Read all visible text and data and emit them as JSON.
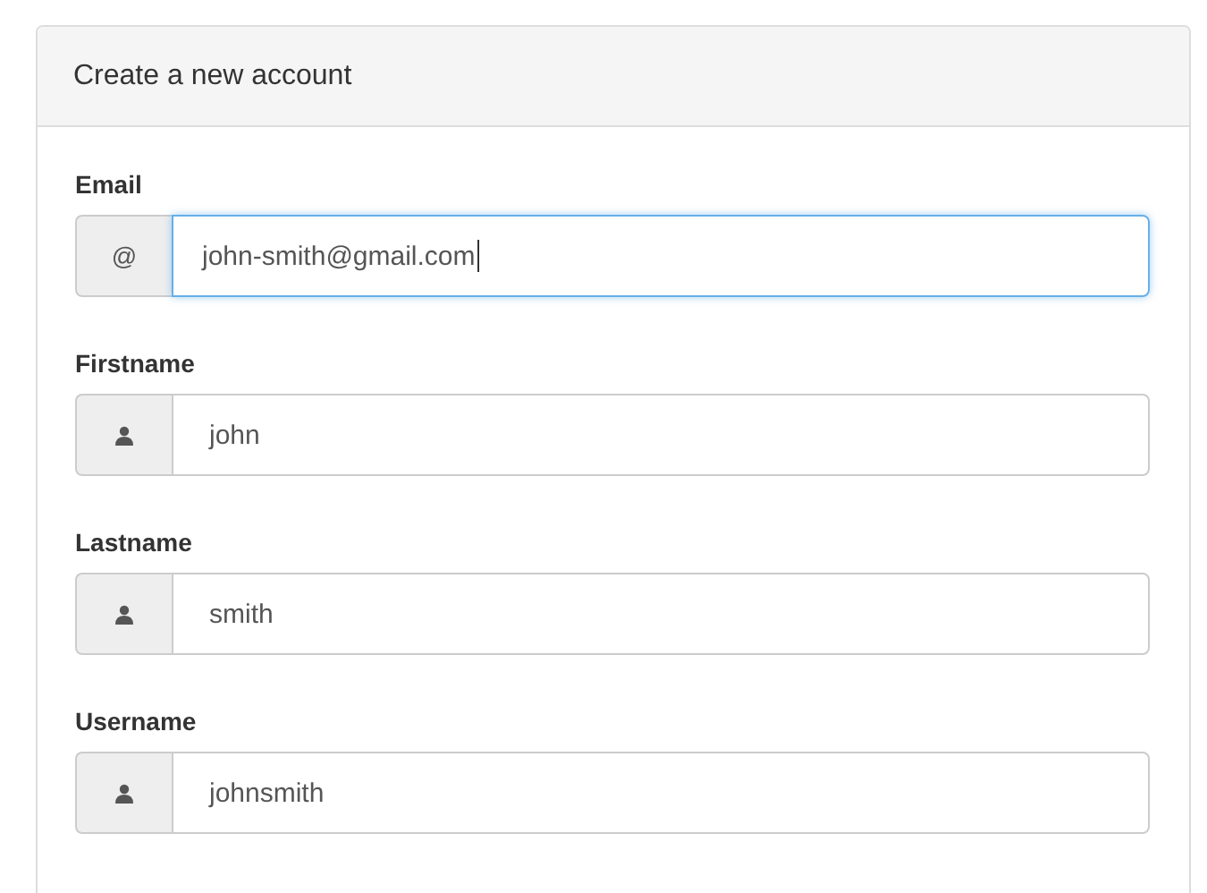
{
  "panel": {
    "title": "Create a new account"
  },
  "fields": [
    {
      "label": "Email",
      "addon": {
        "kind": "text",
        "text": "@"
      },
      "value": "john-smith@gmail.com",
      "focused": true
    },
    {
      "label": "Firstname",
      "addon": {
        "kind": "user"
      },
      "value": "john",
      "focused": false
    },
    {
      "label": "Lastname",
      "addon": {
        "kind": "user"
      },
      "value": "smith",
      "focused": false
    },
    {
      "label": "Username",
      "addon": {
        "kind": "user"
      },
      "value": "johnsmith",
      "focused": false
    }
  ]
}
